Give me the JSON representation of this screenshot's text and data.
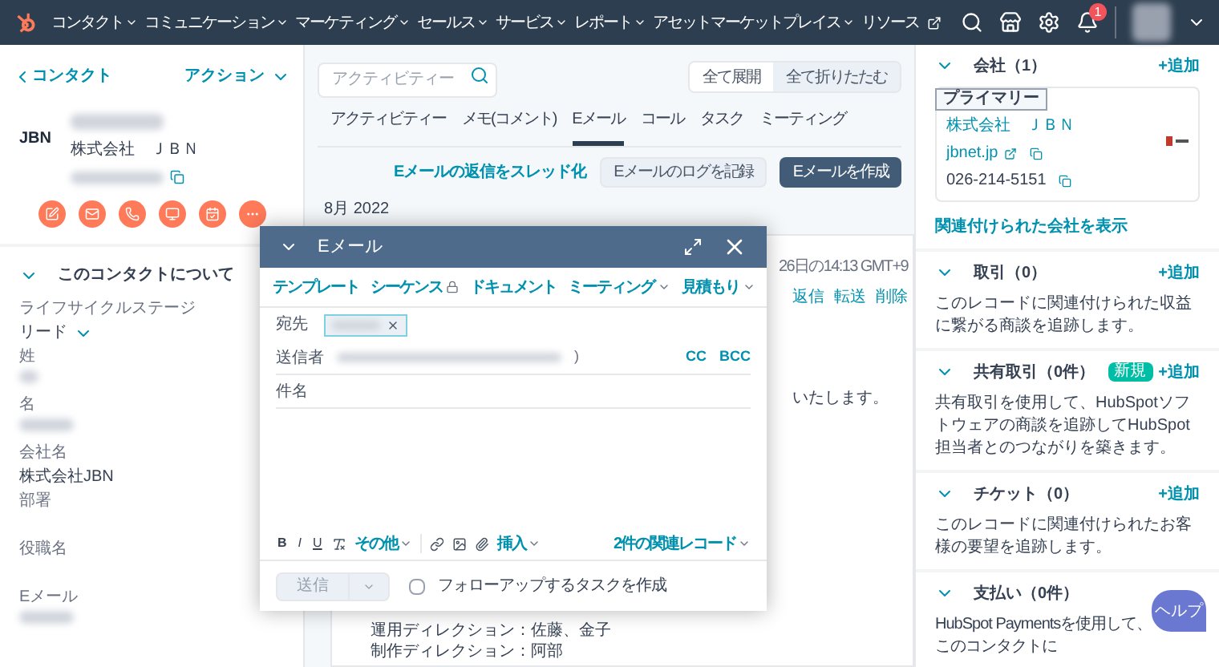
{
  "nav": {
    "menus": [
      {
        "label": "コンタクト",
        "kind": "menu"
      },
      {
        "label": "コミュニケーション",
        "kind": "menu"
      },
      {
        "label": "マーケティング",
        "kind": "menu"
      },
      {
        "label": "セールス",
        "kind": "menu"
      },
      {
        "label": "サービス",
        "kind": "menu"
      },
      {
        "label": "レポート",
        "kind": "menu"
      },
      {
        "label": "アセットマーケットプレイス",
        "kind": "menu"
      },
      {
        "label": "リソース",
        "kind": "external"
      }
    ],
    "notification_count": "1"
  },
  "contact": {
    "back_link": "コンタクト",
    "actions_menu": "アクション",
    "logo_text": "JBN",
    "company": "株式会社　ＪＢＮ",
    "action_buttons": [
      {
        "kind": "note"
      },
      {
        "kind": "email"
      },
      {
        "kind": "call"
      },
      {
        "kind": "log"
      },
      {
        "kind": "task"
      },
      {
        "kind": "more"
      }
    ],
    "about": {
      "title": "このコンタクトについて",
      "expanded": true,
      "fields": [
        {
          "label": "ライフサイクルステージ",
          "kind": "dropdown",
          "value": "リード"
        },
        {
          "label": "姓",
          "kind": "blurred"
        },
        {
          "label": "名",
          "kind": "blurred"
        },
        {
          "label": "会社名",
          "kind": "text",
          "value": "株式会社JBN"
        },
        {
          "label": "部署",
          "kind": "empty"
        },
        {
          "label": "役職名",
          "kind": "empty"
        },
        {
          "label": "Eメール",
          "kind": "blurred"
        }
      ]
    }
  },
  "activity": {
    "search": {
      "placeholder": "アクティビティー"
    },
    "view_buttons": [
      {
        "label": "全て展開",
        "selected": false
      },
      {
        "label": "全て折りたたむ",
        "selected": true
      }
    ],
    "tabs": [
      {
        "label": "アクティビティー",
        "selected": false
      },
      {
        "label": "メモ(コメント)",
        "selected": false
      },
      {
        "label": "Eメール",
        "selected": true
      },
      {
        "label": "コール",
        "selected": false
      },
      {
        "label": "タスク",
        "selected": false
      },
      {
        "label": "ミーティング",
        "selected": false
      }
    ],
    "thread_link": "Eメールの返信をスレッド化",
    "log_button": "Eメールのログを記録",
    "create_button": "Eメールを作成",
    "month": "8月 2022",
    "email_card": {
      "timestamp": "26日の14:13 GMT+9",
      "actions": [
        "返信",
        "転送",
        "削除"
      ],
      "body_tail": "いたします。",
      "lines": [
        "運用ディレクション：佐藤、金子",
        "制作ディレクション：阿部"
      ]
    }
  },
  "composer": {
    "title": "Eメール",
    "toolbar": [
      {
        "label": "テンプレート",
        "kind": "link"
      },
      {
        "label": "シーケンス",
        "kind": "locked"
      },
      {
        "label": "ドキュメント",
        "kind": "link"
      },
      {
        "label": "ミーティング",
        "kind": "dropdown"
      },
      {
        "label": "見積もり",
        "kind": "dropdown"
      }
    ],
    "to_label": "宛先",
    "from_label": "送信者",
    "from_bracket": ")",
    "cc": "CC",
    "bcc": "BCC",
    "subject_label": "件名",
    "format": [
      "B",
      "I",
      "U"
    ],
    "more": "その他",
    "insert": "挿入",
    "associations": "2件の関連レコード",
    "send": {
      "label": "送信",
      "disabled": true
    },
    "followup": {
      "label": "フォローアップするタスクを作成",
      "checked": false
    }
  },
  "sidebar": {
    "sections": [
      {
        "title": "会社（1）",
        "expanded": true,
        "add": "+追加",
        "kind": "company",
        "company": {
          "badge": "プライマリー",
          "name": "株式会社　ＪＢＮ",
          "domain": "jbnet.jp",
          "phone": "026-214-5151"
        },
        "link": "関連付けられた会社を表示"
      },
      {
        "title": "取引（0）",
        "expanded": true,
        "add": "+追加",
        "kind": "text",
        "description": "このレコードに関連付けられた収益に繋がる商談を追跡します。"
      },
      {
        "title": "共有取引（0件）",
        "expanded": true,
        "add": "+追加",
        "kind": "text",
        "badge": "新規",
        "description": "共有取引を使用して、HubSpotソフトウェアの商談を追跡してHubSpot担当者とのつながりを築きます。"
      },
      {
        "title": "チケット（0）",
        "expanded": true,
        "add": "+追加",
        "kind": "text",
        "description": "このレコードに関連付けられたお客様の要望を追跡します。"
      },
      {
        "title": "支払い（0件）",
        "expanded": true,
        "kind": "text",
        "description": "HubSpot Paymentsを使用して、このコンタクトに"
      }
    ]
  },
  "help_button": "ヘルプ"
}
